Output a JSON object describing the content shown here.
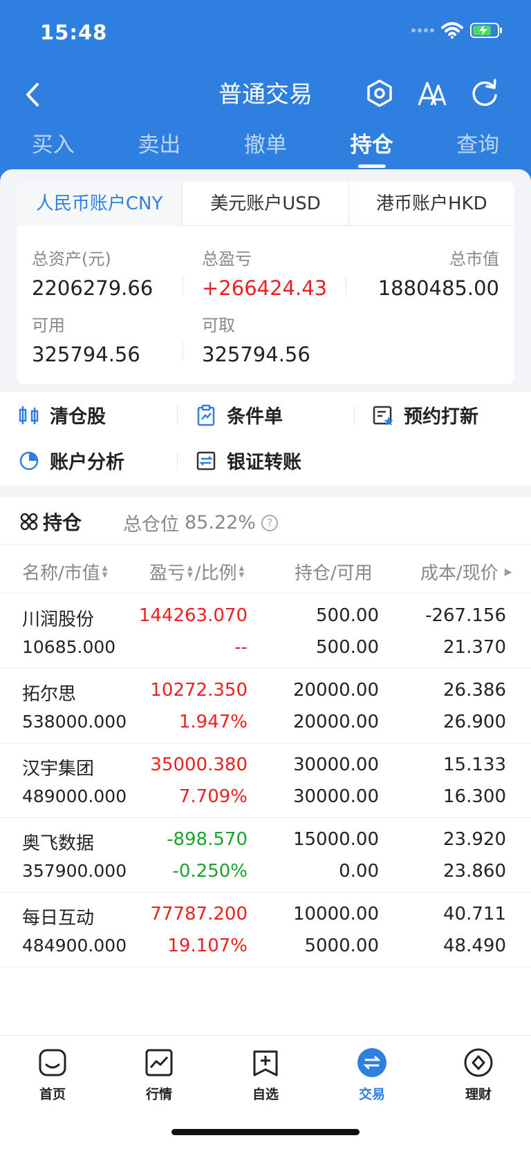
{
  "status_bar": {
    "time": "15:48"
  },
  "nav": {
    "title": "普通交易",
    "tabs": [
      {
        "label": "买入"
      },
      {
        "label": "卖出"
      },
      {
        "label": "撤单"
      },
      {
        "label": "持仓"
      },
      {
        "label": "查询"
      }
    ],
    "active_tab": "持仓"
  },
  "accounts": {
    "tabs": [
      {
        "label": "人民币账户CNY"
      },
      {
        "label": "美元账户USD"
      },
      {
        "label": "港币账户HKD"
      }
    ],
    "metrics": {
      "total_assets_label": "总资产(元)",
      "total_assets": "2206279.66",
      "total_pnl_label": "总盈亏",
      "total_pnl": "+266424.43",
      "market_value_label": "总市值",
      "market_value": "1880485.00",
      "available_label": "可用",
      "available": "325794.56",
      "withdrawable_label": "可取",
      "withdrawable": "325794.56"
    }
  },
  "quick_actions": {
    "clear_stock": "清仓股",
    "conditional_order": "条件单",
    "ipo_booking": "预约打新",
    "account_analysis": "账户分析",
    "bank_transfer": "银证转账"
  },
  "holdings": {
    "title": "持仓",
    "position_ratio_label": "总仓位",
    "position_ratio": "85.22%",
    "columns": {
      "name": "名称/市值",
      "pnl": "盈亏",
      "ratio": "/比例",
      "hold": "持仓/可用",
      "cost": "成本/现价"
    },
    "rows": [
      {
        "name": "川润股份",
        "market_value": "10685.000",
        "pnl": "144263.070",
        "pnl_ratio": "--",
        "hold": "500.00",
        "available": "500.00",
        "cost": "-267.156",
        "price": "21.370"
      },
      {
        "name": "拓尔思",
        "market_value": "538000.000",
        "pnl": "10272.350",
        "pnl_ratio": "1.947%",
        "hold": "20000.00",
        "available": "20000.00",
        "cost": "26.386",
        "price": "26.900"
      },
      {
        "name": "汉宇集团",
        "market_value": "489000.000",
        "pnl": "35000.380",
        "pnl_ratio": "7.709%",
        "hold": "30000.00",
        "available": "30000.00",
        "cost": "15.133",
        "price": "16.300"
      },
      {
        "name": "奥飞数据",
        "market_value": "357900.000",
        "pnl": "-898.570",
        "pnl_ratio": "-0.250%",
        "hold": "15000.00",
        "available": "0.00",
        "cost": "23.920",
        "price": "23.860"
      },
      {
        "name": "每日互动",
        "market_value": "484900.000",
        "pnl": "77787.200",
        "pnl_ratio": "19.107%",
        "hold": "10000.00",
        "available": "5000.00",
        "cost": "40.711",
        "price": "48.490"
      }
    ]
  },
  "bottom_nav": [
    {
      "label": "首页",
      "icon": "home-icon"
    },
    {
      "label": "行情",
      "icon": "chart-icon"
    },
    {
      "label": "自选",
      "icon": "watchlist-icon"
    },
    {
      "label": "交易",
      "icon": "trade-icon"
    },
    {
      "label": "理财",
      "icon": "wealth-icon"
    }
  ],
  "colors": {
    "brand": "#2f7fe0",
    "up": "#ee1f1f",
    "down": "#19a32b"
  }
}
